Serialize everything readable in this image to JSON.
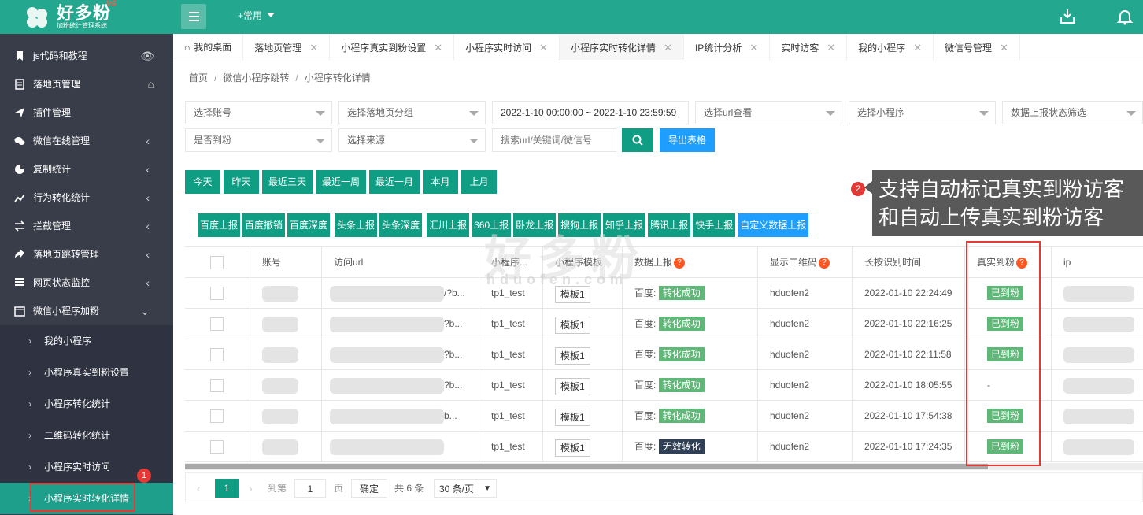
{
  "app": {
    "logo_title": "好多粉",
    "logo_sub": "加粉统计管理系统",
    "logo_version": "V5",
    "common_menu": "+常用"
  },
  "sidebar": {
    "items": [
      {
        "label": "js代码和教程",
        "icon": "bookmark-icon",
        "right": "eye"
      },
      {
        "label": "落地页管理",
        "icon": "document-icon",
        "right": "home"
      },
      {
        "label": "插件管理",
        "icon": "send-icon",
        "right": ""
      },
      {
        "label": "微信在线管理",
        "icon": "wechat-icon",
        "right": "<"
      },
      {
        "label": "复制统计",
        "icon": "pie-chart-icon",
        "right": "<"
      },
      {
        "label": "行为转化统计",
        "icon": "line-chart-icon",
        "right": "<"
      },
      {
        "label": "拦截管理",
        "icon": "exchange-icon",
        "right": "<"
      },
      {
        "label": "落地页跳转管理",
        "icon": "share-icon",
        "right": "<"
      },
      {
        "label": "网页状态监控",
        "icon": "list-icon",
        "right": "<"
      },
      {
        "label": "微信小程序加粉",
        "icon": "calendar-icon",
        "right": "v"
      }
    ],
    "subitems": [
      {
        "label": "我的小程序"
      },
      {
        "label": "小程序真实到粉设置"
      },
      {
        "label": "小程序转化统计"
      },
      {
        "label": "二维码转化统计"
      },
      {
        "label": "小程序实时访问"
      },
      {
        "label": "小程序实时转化详情"
      }
    ]
  },
  "tabs": [
    {
      "label": "我的桌面",
      "home": true
    },
    {
      "label": "落地页管理"
    },
    {
      "label": "小程序真实到粉设置"
    },
    {
      "label": "小程序实时访问"
    },
    {
      "label": "小程序实时转化详情",
      "active": true
    },
    {
      "label": "IP统计分析"
    },
    {
      "label": "实时访客"
    },
    {
      "label": "我的小程序"
    },
    {
      "label": "微信号管理"
    }
  ],
  "breadcrumb": [
    "首页",
    "微信小程序跳转",
    "小程序转化详情"
  ],
  "filters": {
    "account": "选择账号",
    "landing_group": "选择落地页分组",
    "date_range": "2022-1-10 00:00:00 ~ 2022-1-10 23:59:59",
    "url_view": "选择url查看",
    "miniprogram": "选择小程序",
    "report_status": "数据上报状态筛选",
    "is_arrived": "是否到粉",
    "source": "选择来源",
    "search_placeholder": "搜索url/关键词/微信号",
    "export": "导出表格"
  },
  "quick_dates": [
    "今天",
    "昨天",
    "最近三天",
    "最近一周",
    "最近一月",
    "本月",
    "上月"
  ],
  "report_buttons": [
    "百度上报",
    "百度撤销",
    "百度深度",
    "头条上报",
    "头条深度",
    "汇川上报",
    "360上报",
    "卧龙上报",
    "搜狗上报",
    "知乎上报",
    "腾讯上报",
    "快手上报"
  ],
  "report_custom": "自定义数据上报",
  "table": {
    "headers": [
      "账号",
      "访问url",
      "小程序...",
      "小程序模板",
      "数据上报",
      "显示二维码",
      "长按识别时间",
      "真实到粉",
      "ip"
    ],
    "rows": [
      {
        "url_tail": "/?b...",
        "mp": "tp1_test",
        "tmpl": "模板1",
        "report_prefix": "百度:",
        "report": "转化成功",
        "report_ok": true,
        "qr": "hduofen2",
        "time": "2022-01-10 22:24:49",
        "arrived": "已到粉"
      },
      {
        "url_tail": "?b...",
        "mp": "tp1_test",
        "tmpl": "模板1",
        "report_prefix": "百度:",
        "report": "转化成功",
        "report_ok": true,
        "qr": "hduofen2",
        "time": "2022-01-10 22:16:25",
        "arrived": "已到粉"
      },
      {
        "url_tail": "?b...",
        "mp": "tp1_test",
        "tmpl": "模板1",
        "report_prefix": "百度:",
        "report": "转化成功",
        "report_ok": true,
        "qr": "hduofen2",
        "time": "2022-01-10 22:11:58",
        "arrived": "已到粉"
      },
      {
        "url_tail": "?b...",
        "mp": "tp1_test",
        "tmpl": "模板1",
        "report_prefix": "百度:",
        "report": "转化成功",
        "report_ok": true,
        "qr": "hduofen2",
        "time": "2022-01-10 18:05:55",
        "arrived": "-"
      },
      {
        "url_tail": "b...",
        "mp": "tp1_test",
        "tmpl": "模板1",
        "report_prefix": "百度:",
        "report": "转化成功",
        "report_ok": true,
        "qr": "hduofen2",
        "time": "2022-01-10 17:54:38",
        "arrived": "已到粉"
      },
      {
        "url_tail": "",
        "mp": "tp1_test",
        "tmpl": "模板1",
        "report_prefix": "百度:",
        "report": "无效转化",
        "report_ok": false,
        "qr": "hduofen2",
        "time": "2022-01-10 17:24:35",
        "arrived": "已到粉"
      }
    ]
  },
  "pager": {
    "page": "1",
    "goto_label": "到第",
    "goto_value": "1",
    "page_unit": "页",
    "confirm": "确定",
    "total": "共 6 条",
    "per_page": "30 条/页"
  },
  "annotations": {
    "badge1": "1",
    "badge2": "2",
    "tooltip_line1": "支持自动标记真实到粉访客",
    "tooltip_line2": "和自动上传真实到粉访客"
  },
  "watermark": {
    "cn": "好多粉",
    "en": "hduofen.com"
  },
  "colors": {
    "brand": "#23a78e",
    "sidebar": "#393d49",
    "button": "#0f9d84",
    "blue": "#1e9fff",
    "tag_green": "#5fb878",
    "tag_dark": "#2f4056",
    "annotation_red": "#e53935"
  }
}
